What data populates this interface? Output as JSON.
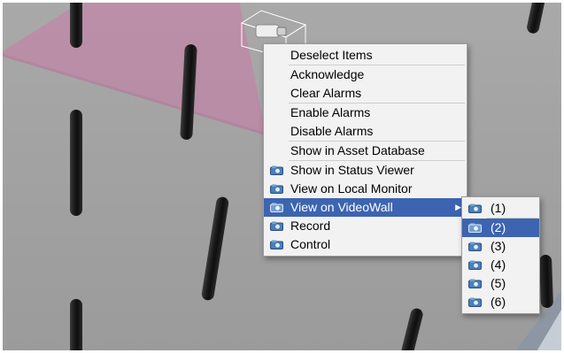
{
  "context_menu": {
    "items": [
      {
        "label": "Deselect Items",
        "icon": "",
        "highlighted": false
      },
      {
        "label": "Acknowledge",
        "icon": "",
        "highlighted": false
      },
      {
        "label": "Clear Alarms",
        "icon": "",
        "highlighted": false
      },
      {
        "label": "Enable Alarms",
        "icon": "",
        "highlighted": false
      },
      {
        "label": "Disable Alarms",
        "icon": "",
        "highlighted": false
      },
      {
        "label": "Show in Asset Database",
        "icon": "",
        "highlighted": false
      },
      {
        "label": "Show in Status Viewer",
        "icon": "camera-icon",
        "highlighted": false
      },
      {
        "label": "View on Local Monitor",
        "icon": "camera-icon",
        "highlighted": false
      },
      {
        "label": "View on VideoWall",
        "icon": "camera-icon",
        "highlighted": true,
        "submenu_arrow": "▶"
      },
      {
        "label": "Record",
        "icon": "camera-icon",
        "highlighted": false
      },
      {
        "label": "Control",
        "icon": "camera-icon",
        "highlighted": false
      }
    ]
  },
  "videowall_submenu": {
    "items": [
      {
        "label": "(1)",
        "icon": "camera-icon",
        "highlighted": false
      },
      {
        "label": "(2)",
        "icon": "camera-icon",
        "highlighted": true
      },
      {
        "label": "(3)",
        "icon": "camera-icon",
        "highlighted": false
      },
      {
        "label": "(4)",
        "icon": "camera-icon",
        "highlighted": false
      },
      {
        "label": "(5)",
        "icon": "camera-icon",
        "highlighted": false
      },
      {
        "label": "(6)",
        "icon": "camera-icon",
        "highlighted": false
      }
    ]
  },
  "colors": {
    "highlight": "#3d64b0",
    "menu_bg": "#f2f2f2",
    "frustum": "#c97aa6",
    "floor": "#a5a5a5"
  }
}
